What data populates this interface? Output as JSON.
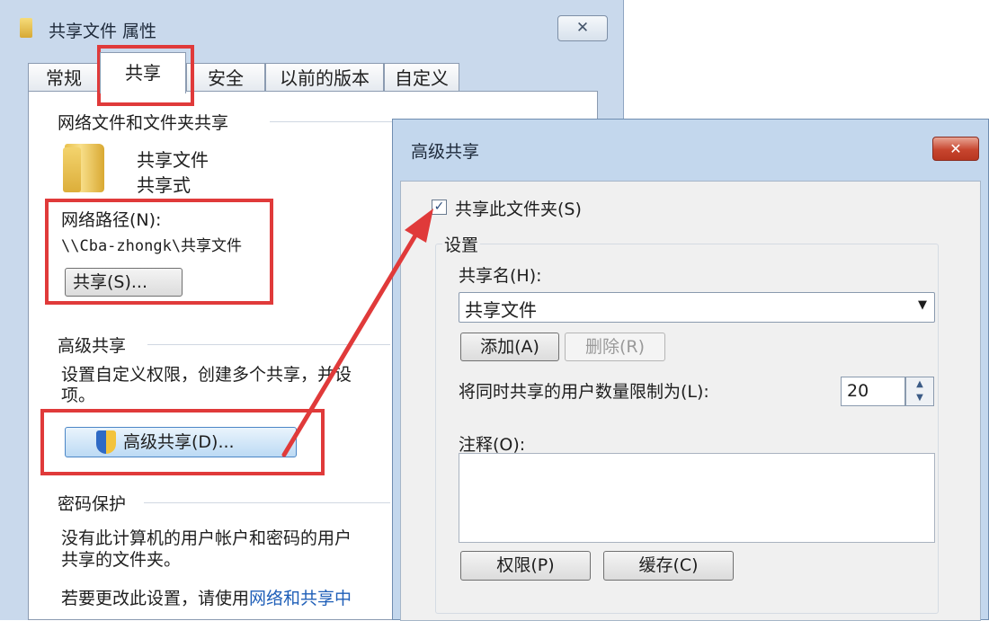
{
  "props": {
    "title": "共享文件 属性",
    "close_label": "✕",
    "tabs": [
      "常规",
      "共享",
      "安全",
      "以前的版本",
      "自定义"
    ],
    "network_section_title": "网络文件和文件夹共享",
    "folder_name": "共享文件",
    "folder_status": "共享式",
    "network_path_label": "网络路径(N):",
    "network_path_value": "\\\\Cba-zhongk\\共享文件",
    "share_button": "共享(S)...",
    "advanced_section_title": "高级共享",
    "advanced_desc_line1": "设置自定义权限，创建多个共享，并设",
    "advanced_desc_line2": "项。",
    "advanced_button": "高级共享(D)...",
    "password_section_title": "密码保护",
    "password_desc_line1": "没有此计算机的用户帐户和密码的用户",
    "password_desc_line2": "共享的文件夹。",
    "change_setting_prefix": "若要更改此设置，请使用",
    "change_setting_link": "网络和共享中"
  },
  "advanced": {
    "title": "高级共享",
    "close_label": "✕",
    "share_checkbox_label": "共享此文件夹(S)",
    "share_checked": true,
    "settings_label": "设置",
    "share_name_label": "共享名(H):",
    "share_name_value": "共享文件",
    "add_button": "添加(A)",
    "remove_button": "删除(R)",
    "limit_label": "将同时共享的用户数量限制为(L):",
    "limit_value": "20",
    "comment_label": "注释(O):",
    "permissions_button": "权限(P)",
    "caching_button": "缓存(C)"
  },
  "colors": {
    "highlight_red": "#e03a3a",
    "link_blue": "#1f5fb8"
  }
}
